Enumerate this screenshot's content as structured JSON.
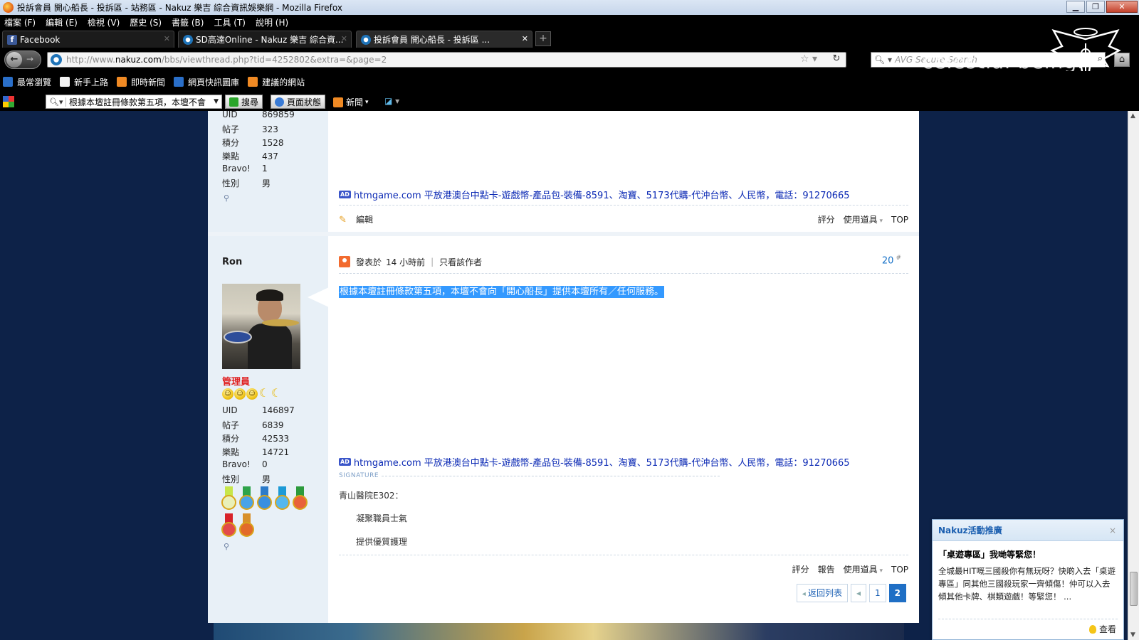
{
  "window": {
    "title": "投訴會員 開心船長 - 投訴區 - 站務區 - Nakuz 樂吉 綜合資訊娛樂網 - Mozilla Firefox",
    "controls": [
      "▁",
      "❐",
      "✕"
    ]
  },
  "menu": [
    "檔案 (F)",
    "編輯 (E)",
    "檢視 (V)",
    "歷史 (S)",
    "書籤 (B)",
    "工具 (T)",
    "說明 (H)"
  ],
  "tabs": [
    {
      "label": "Facebook",
      "color": "#3b5998"
    },
    {
      "label": "SD高達Online - Nakuz 樂吉 綜合資...",
      "color": "#1e73b8"
    },
    {
      "label": "投訴會員 開心船長 - 投訴區 ...",
      "color": "#1e73b8"
    }
  ],
  "nav": {
    "url_prefix": "http://www.",
    "url_domain": "nakuz.com",
    "url_rest": "/bbs/viewthread.php?tid=4252802&extra=&page=2",
    "search_placeholder": "AVG Secure Search",
    "brand": "celestial being."
  },
  "bookmarks": [
    {
      "label": "最常瀏覽",
      "color": "#2a6fc9"
    },
    {
      "label": "新手上路",
      "color": "#f2f2f2"
    },
    {
      "label": "即時新聞",
      "color": "#f08a24"
    },
    {
      "label": "網頁快訊圖庫",
      "color": "#2a6fc9"
    },
    {
      "label": "建議的網站",
      "color": "#f08a24"
    }
  ],
  "toolbar": {
    "search_text": "根據本壇註冊條款第五項，本壇不會",
    "search_button": "搜尋",
    "page_status": "頁面狀態",
    "news": "新聞"
  },
  "post1": {
    "stats": [
      {
        "k": "UID",
        "v": "869859"
      },
      {
        "k": "帖子",
        "v": "323"
      },
      {
        "k": "積分",
        "v": "1528"
      },
      {
        "k": "樂點",
        "v": "437"
      },
      {
        "k": "Bravo!",
        "v": "1"
      },
      {
        "k": "性別",
        "v": "男"
      }
    ],
    "ad": "htmgame.com 平放港澳台中點卡-遊戲幣-產品包-裝備-8591、淘寶、5173代購-代沖台幣、人民幣，電話：91270665",
    "edit": "編輯",
    "actions": [
      "評分",
      "使用道具",
      "TOP"
    ]
  },
  "post2": {
    "author": "Ron",
    "role": "管理員",
    "stats": [
      {
        "k": "UID",
        "v": "146897"
      },
      {
        "k": "帖子",
        "v": "6839"
      },
      {
        "k": "積分",
        "v": "42533"
      },
      {
        "k": "樂點",
        "v": "14721"
      },
      {
        "k": "Bravo!",
        "v": "0"
      },
      {
        "k": "性別",
        "v": "男"
      }
    ],
    "posted_prefix": "發表於",
    "posted_time": "14 小時前",
    "only_author": "只看該作者",
    "floor": "20",
    "floor_mark": "#",
    "body": "根據本壇註冊條款第五項，本壇不會向「開心船長」提供本壇所有／任何服務。",
    "ad": "htmgame.com 平放港澳台中點卡-遊戲幣-產品包-裝備-8591、淘寶、5173代購-代沖台幣、人民幣，電話：91270665",
    "signature_label": "SIGNATURE",
    "signature": [
      "青山醫院E302：",
      "凝聚職員士氣",
      "提供優質護理"
    ],
    "actions": [
      "評分",
      "報告",
      "使用道具",
      "TOP"
    ]
  },
  "pager": {
    "back": "返回列表",
    "prev": "◂",
    "pages": [
      "1",
      "2"
    ],
    "current": "2"
  },
  "popup": {
    "header": "Nakuz活動推廣",
    "close": "×",
    "title": "「桌遊專區」我哋等緊您！",
    "text": "全城最HIT嘅三國殺你有無玩呀？快啲入去「桌遊專區」同其他三國殺玩家一齊傾傷！仲可以入去傾其他卡牌、棋類遊戲！等緊您！ ...",
    "more": "查看"
  },
  "colors": {
    "accent": "#1f6fc5",
    "role": "#e02020",
    "ad_link": "#0a28b4",
    "selection": "#3399ff"
  }
}
